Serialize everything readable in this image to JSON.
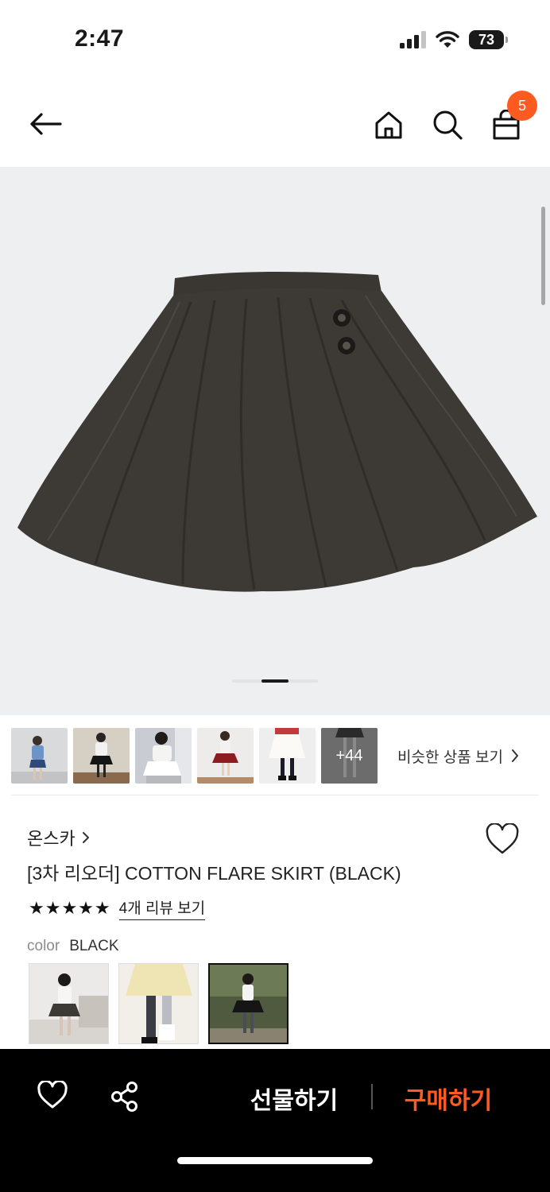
{
  "status_bar": {
    "time": "2:47",
    "battery": "73"
  },
  "nav": {
    "cart_count": "5"
  },
  "thumbnails": {
    "more_label": "+44",
    "similar_label": "비슷한 상품 보기"
  },
  "product": {
    "brand": "온스카",
    "title": "[3차 리오더] COTTON FLARE SKIRT (BLACK)",
    "rating_stars": 5,
    "review_link": "4개 리뷰 보기",
    "color_label": "color",
    "color_value": "BLACK"
  },
  "bottom_bar": {
    "gift_label": "선물하기",
    "buy_label": "구매하기"
  },
  "colors": {
    "accent": "#ff5a1f",
    "skirt": "#3d3a36",
    "hero_bg": "#eeeff1"
  }
}
